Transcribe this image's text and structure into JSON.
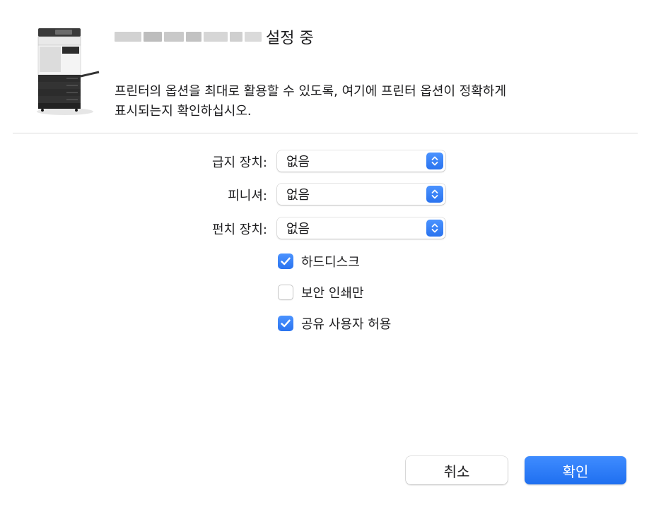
{
  "dialog": {
    "title_suffix": "설정 중",
    "description_line1": "프린터의 옵션을 최대로 활용할 수 있도록, 여기에 프린터 옵션이 정확하게",
    "description_line2": "표시되는지 확인하십시오."
  },
  "options": {
    "paper_feeder": {
      "label": "급지 장치:",
      "value": "없음"
    },
    "finisher": {
      "label": "피니셔:",
      "value": "없음"
    },
    "punch": {
      "label": "펀치 장치:",
      "value": "없음"
    }
  },
  "checkboxes": [
    {
      "label": "하드디스크",
      "checked": true
    },
    {
      "label": "보안 인쇄만",
      "checked": false
    },
    {
      "label": "공유 사용자 허용",
      "checked": true
    }
  ],
  "buttons": {
    "cancel": "취소",
    "ok": "확인"
  },
  "colors": {
    "accent": "#2f7cf6"
  },
  "icons": {
    "stepper": "up-down-chevron-icon",
    "check": "checkmark-icon",
    "device": "printer-icon"
  }
}
